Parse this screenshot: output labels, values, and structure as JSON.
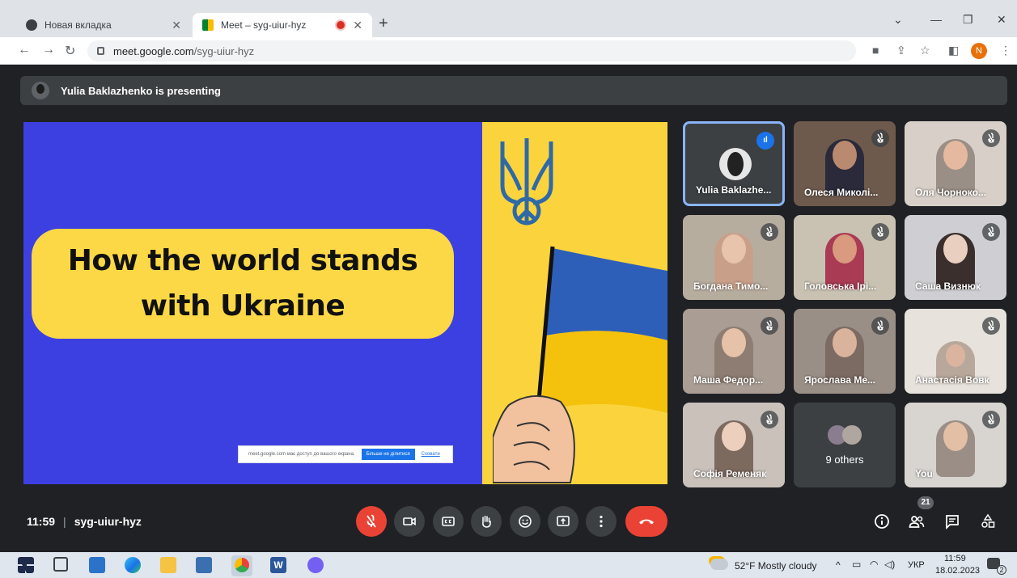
{
  "browser": {
    "tabs": [
      {
        "title": "Новая вкладка",
        "active": false
      },
      {
        "title": "Meet – syg-uiur-hyz",
        "active": true
      }
    ],
    "url_host": "meet.google.com",
    "url_path": "/syg-uiur-hyz",
    "profile_initial": "N"
  },
  "meet": {
    "presenting_banner": "Yulia Baklazhenko is presenting",
    "slide": {
      "title_line1": "How the world stands",
      "title_line2": "with Ukraine",
      "share_notice": "meet.google.com має доступ до вашого екрана.",
      "share_stop_button": "Більше не ділитися",
      "share_hide_link": "Сховати"
    },
    "participants": [
      {
        "name": "Yulia Baklazhe...",
        "speaking": true,
        "muted": false
      },
      {
        "name": "Олеся Миколі...",
        "muted": true
      },
      {
        "name": "Оля Чорноко...",
        "muted": true
      },
      {
        "name": "Богдана Тимо...",
        "muted": true
      },
      {
        "name": "Головська Ірі...",
        "muted": true
      },
      {
        "name": "Саша Визнюк",
        "muted": true
      },
      {
        "name": "Маша Федор...",
        "muted": true
      },
      {
        "name": "Ярослава Ме...",
        "muted": true
      },
      {
        "name": "Анастасія Вовк",
        "muted": true
      },
      {
        "name": "Софія Ременяк",
        "muted": true
      },
      {
        "name": "9 others",
        "muted": false
      },
      {
        "name": "You",
        "muted": true
      }
    ],
    "time": "11:59",
    "meeting_code": "syg-uiur-hyz",
    "people_count": "21"
  },
  "taskbar": {
    "weather": "52°F  Mostly cloudy",
    "language": "УКР",
    "clock_time": "11:59",
    "clock_date": "18.02.2023",
    "notifications": "2"
  },
  "colors": {
    "meet_bg": "#202124",
    "slide_blue": "#3d40e0",
    "slide_yellow": "#fbd43d",
    "mute_red": "#ea4335",
    "speaking_blue": "#8ab4f8"
  }
}
